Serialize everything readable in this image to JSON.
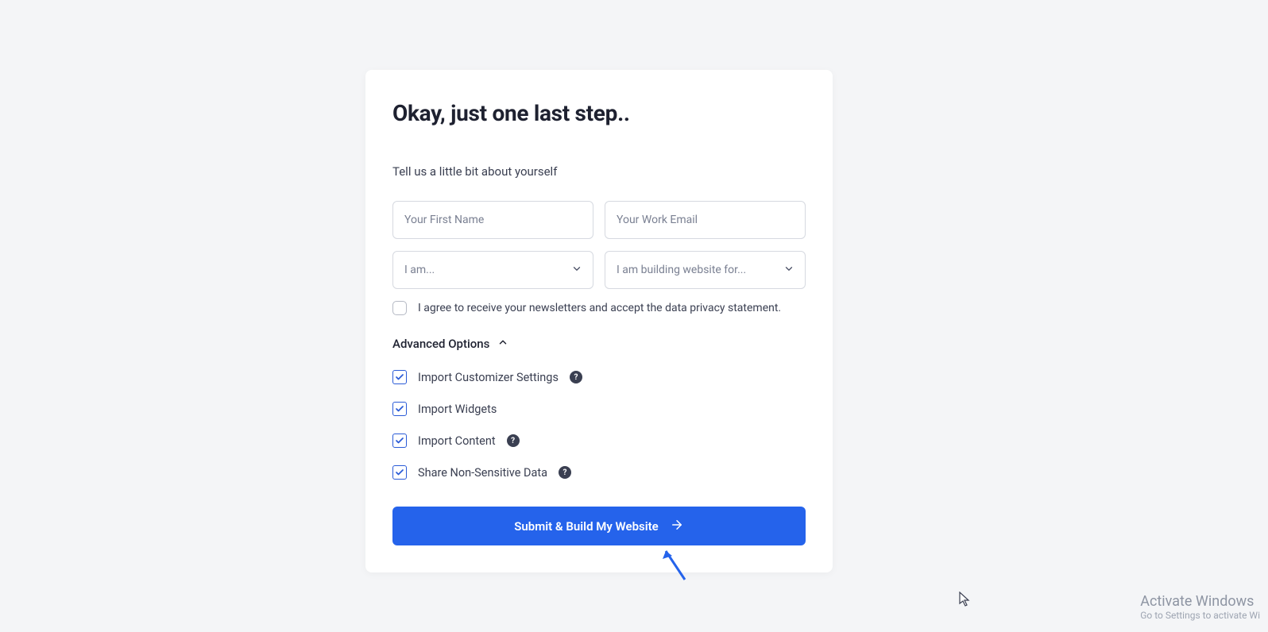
{
  "heading": "Okay, just one last step..",
  "subheading": "Tell us a little bit about yourself",
  "fields": {
    "first_name_placeholder": "Your First Name",
    "email_placeholder": "Your Work Email",
    "role_placeholder": "I am...",
    "building_for_placeholder": "I am building website for..."
  },
  "consent": {
    "label": "I agree to receive your newsletters and accept the data privacy statement.",
    "checked": false
  },
  "advanced": {
    "toggle_label": "Advanced Options",
    "expanded": true,
    "options": [
      {
        "label": "Import Customizer Settings",
        "checked": true,
        "help": true
      },
      {
        "label": "Import Widgets",
        "checked": true,
        "help": false
      },
      {
        "label": "Import Content",
        "checked": true,
        "help": true
      },
      {
        "label": "Share Non-Sensitive Data",
        "checked": true,
        "help": true
      }
    ]
  },
  "submit_label": "Submit & Build My Website",
  "watermark": {
    "title": "Activate Windows",
    "sub": "Go to Settings to activate Wi"
  }
}
